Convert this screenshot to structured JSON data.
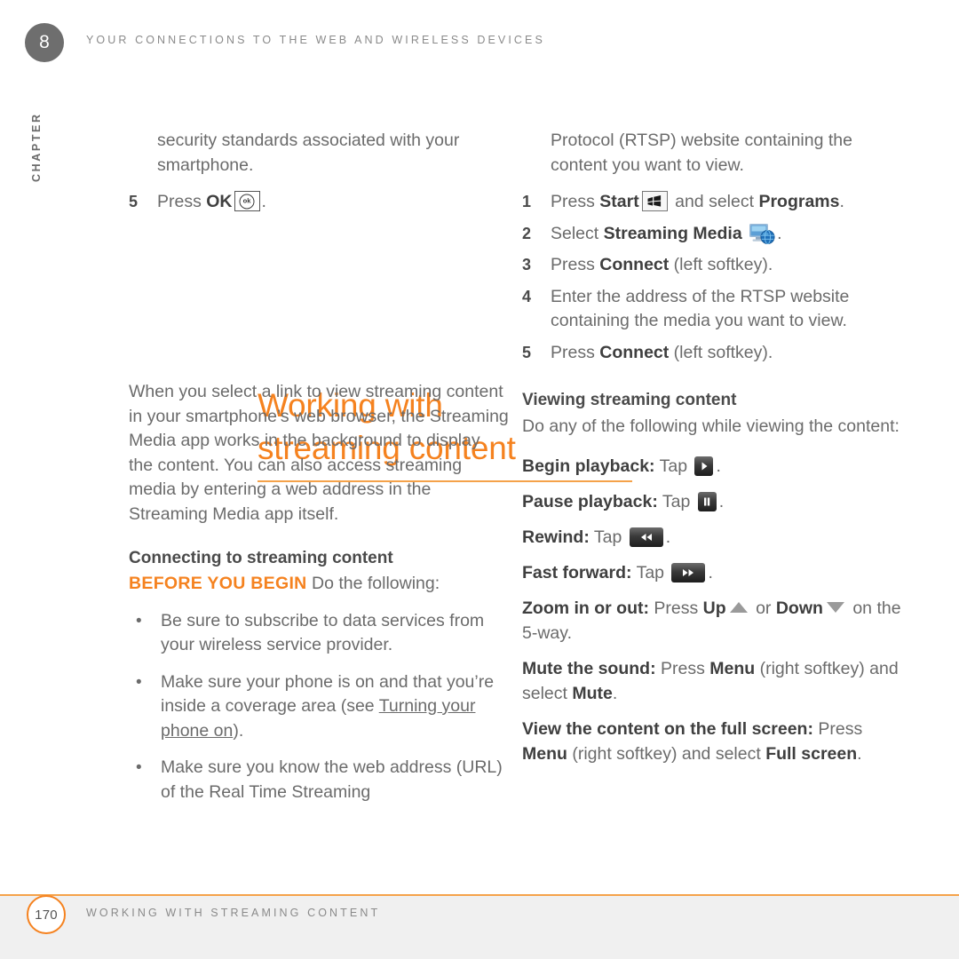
{
  "header": {
    "chapter_number": "8",
    "chapter_label": "CHAPTER",
    "running_head": "YOUR CONNECTIONS TO THE WEB AND WIRELESS DEVICES"
  },
  "colors": {
    "accent_orange": "#F5821F",
    "rule_orange": "#F5A24A",
    "body_gray": "#6B6B6B",
    "bold_gray": "#3F3F3F",
    "badge_gray": "#6E6E6E",
    "footer_band": "#F0F0F0"
  },
  "left_column": {
    "continuation_paragraph": "security standards associated with your smartphone.",
    "continued_step": {
      "number": "5",
      "text_before": "Press ",
      "bold": "OK",
      "icon": "ok-key-icon",
      "text_after": "."
    },
    "title_line1": "Working with",
    "title_line2": "streaming content",
    "intro_paragraph": "When you select a link to view streaming content in your smartphone’s web browser, the Streaming Media app works in the background to display the content. You can also access streaming media by entering a web address in the Streaming Media app itself.",
    "subhead": "Connecting to streaming content",
    "before_you_begin_label": "BEFORE YOU BEGIN",
    "before_you_begin_text": "Do the following:",
    "bullets": [
      {
        "text": "Be sure to subscribe to data services from your wireless service provider."
      },
      {
        "text_before": "Make sure your phone is on and that you’re inside a coverage area (see ",
        "xref": "Turning your phone on",
        "text_after": ")."
      },
      {
        "text": "Make sure you know the web address (URL) of the Real Time Streaming"
      }
    ]
  },
  "right_column": {
    "continuation_paragraph": "Protocol (RTSP) website containing the content you want to view.",
    "steps": [
      {
        "number": "1",
        "parts": [
          "Press ",
          "Start",
          " ",
          "[start-key-icon]",
          " and select ",
          "Programs",
          "."
        ],
        "text_before": "Press ",
        "bold1": "Start",
        "icon": "start-key-icon",
        "text_mid": " and select ",
        "bold2": "Programs",
        "text_after": "."
      },
      {
        "number": "2",
        "text_before": "Select ",
        "bold1": "Streaming Media",
        "icon": "streaming-media-icon",
        "text_after": "."
      },
      {
        "number": "3",
        "text_before": "Press ",
        "bold1": "Connect",
        "text_after": " (left softkey)."
      },
      {
        "number": "4",
        "text_before": "Enter the address of the RTSP website containing the media you want to view.",
        "bold1": "",
        "text_after": ""
      },
      {
        "number": "5",
        "text_before": "Press ",
        "bold1": "Connect",
        "text_after": " (left softkey)."
      }
    ],
    "subhead": "Viewing streaming content",
    "intro": "Do any of the following while viewing the content:",
    "actions": [
      {
        "term": "Begin playback:",
        "text_before": " Tap ",
        "icon": "play-button-icon",
        "text_after": "."
      },
      {
        "term": "Pause playback:",
        "text_before": " Tap ",
        "icon": "pause-button-icon",
        "text_after": "."
      },
      {
        "term": "Rewind:",
        "text_before": " Tap ",
        "icon": "rewind-button-icon",
        "text_after": "."
      },
      {
        "term": "Fast forward:",
        "text_before": " Tap ",
        "icon": "fast-forward-button-icon",
        "text_after": "."
      },
      {
        "term": "Zoom in or out:",
        "text_before": " Press ",
        "bold1": "Up",
        "icon1": "up-arrow-icon",
        "text_mid": " or ",
        "bold2": "Down",
        "icon2": "down-arrow-icon",
        "text_after": " on the 5-way."
      },
      {
        "term": "Mute the sound:",
        "text_before": " Press ",
        "bold1": "Menu",
        "text_mid": " (right softkey) and select ",
        "bold2": "Mute",
        "text_after": "."
      },
      {
        "term": "View the content on the full screen:",
        "text_before": " Press ",
        "bold1": "Menu",
        "text_mid": " (right softkey) and select ",
        "bold2": "Full screen",
        "text_after": "."
      }
    ]
  },
  "footer": {
    "page_number": "170",
    "title": "WORKING WITH STREAMING CONTENT"
  },
  "icons": {
    "ok_key": "ok",
    "start_key": "windows-flag",
    "streaming_media": "monitor-globe",
    "play": "▶",
    "pause": "❘❘",
    "rewind": "◀◀",
    "fast_forward": "▶▶",
    "up": "▲",
    "down": "▼"
  }
}
